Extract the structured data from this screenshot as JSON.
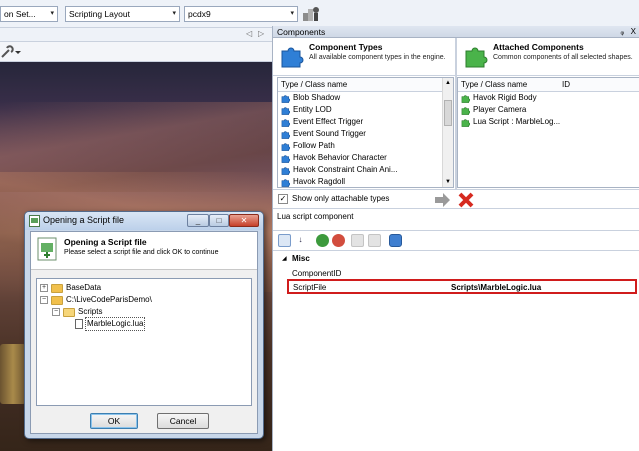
{
  "toolbar": {
    "combo1": "on Set...",
    "combo2": "Scripting Layout",
    "combo3": "pcdx9",
    "arrow": "▾"
  },
  "viewport": {
    "nav_left": "◁",
    "nav_right": "▷"
  },
  "components": {
    "title": "Components",
    "pin": "ᵩ",
    "close": "X",
    "types": {
      "title": "Component Types",
      "subtitle": "All available component types in the engine.",
      "column": "Type / Class name",
      "items": [
        "Blob Shadow",
        "Entity LOD",
        "Event Effect Trigger",
        "Event Sound Trigger",
        "Follow Path",
        "Havok Behavior Character",
        "Havok Constraint Chain Ani...",
        "Havok Ragdoll"
      ]
    },
    "attached": {
      "title": "Attached Components",
      "subtitle": "Common components of all selected shapes.",
      "column_type": "Type / Class name",
      "column_id": "ID",
      "items": [
        "Havok Rigid Body",
        "Player Camera",
        "Lua Script : MarbleLog..."
      ]
    },
    "show_only": "Show only attachable types",
    "description": "Lua script component"
  },
  "properties": {
    "category": "Misc",
    "rows": [
      {
        "name": "ComponentID",
        "value": ""
      },
      {
        "name": "ScriptFile",
        "value": "Scripts\\MarbleLogic.lua"
      }
    ],
    "accent": "#d01c1c"
  },
  "dialog": {
    "title": "Opening a Script file",
    "heading": "Opening a Script file",
    "subheading": "Please select a script file and click OK to continue",
    "tree": {
      "root1": "BaseData",
      "root2": "C:\\LiveCodeParisDemo\\",
      "child": "Scripts",
      "file": "MarbleLogic.lua"
    },
    "ok": "OK",
    "cancel": "Cancel"
  }
}
